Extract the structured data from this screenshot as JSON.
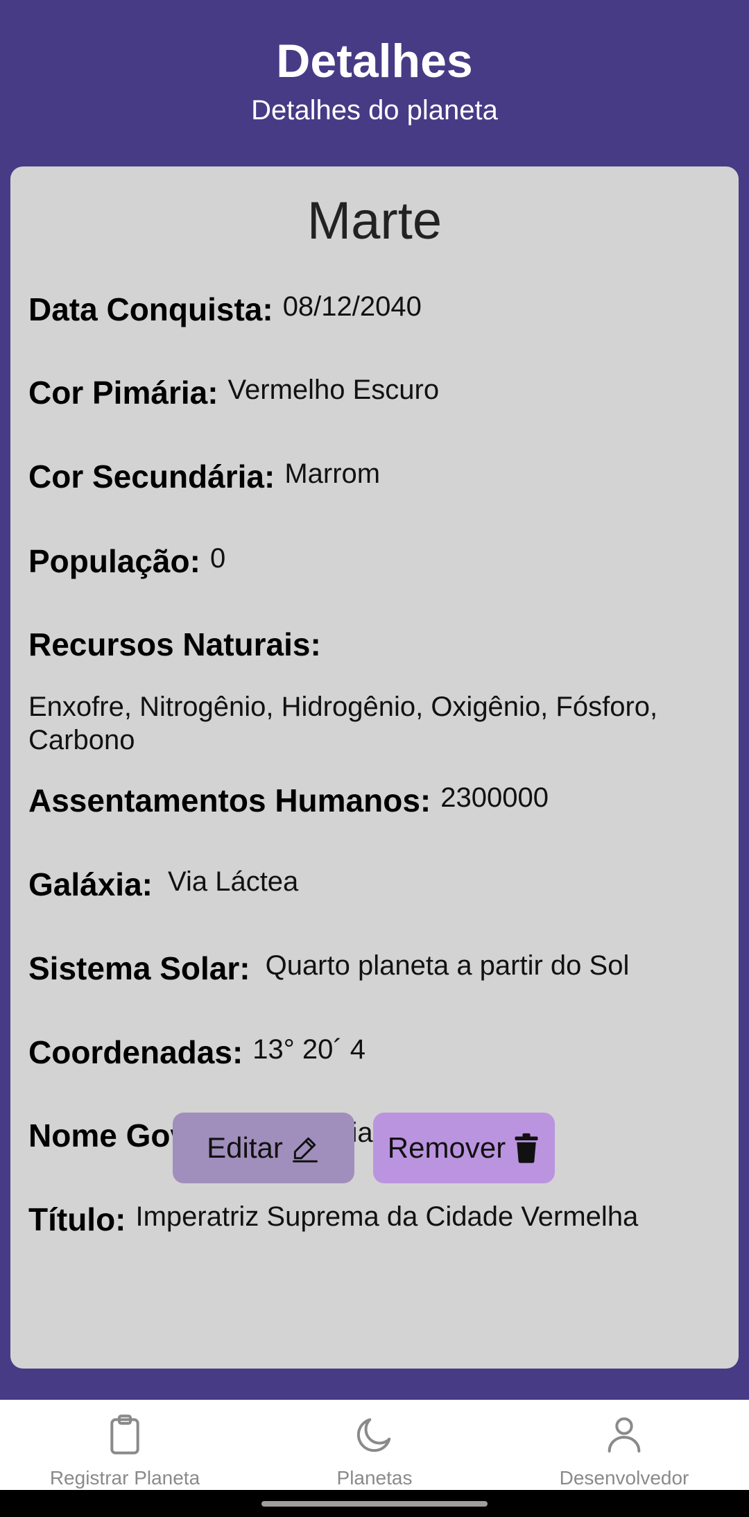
{
  "header": {
    "title": "Detalhes",
    "subtitle": "Detalhes do planeta"
  },
  "planet": {
    "name": "Marte",
    "fields": {
      "conquest_date": {
        "label": "Data Conquista:",
        "value": "08/12/2040"
      },
      "primary_color": {
        "label": "Cor Pimária:",
        "value": "Vermelho Escuro"
      },
      "secondary_color": {
        "label": "Cor Secundária:",
        "value": "Marrom"
      },
      "population": {
        "label": "População:",
        "value": "0"
      },
      "natural_resources": {
        "label": "Recursos Naturais:",
        "value": "Enxofre, Nitrogênio, Hidrogênio, Oxigênio, Fósforo, Carbono"
      },
      "human_settlements": {
        "label": "Assentamentos Humanos:",
        "value": "2300000"
      },
      "galaxy": {
        "label": "Galáxia:",
        "value": "Via Láctea"
      },
      "solar_system": {
        "label": "Sistema Solar:",
        "value": "Quarto planeta a partir do Sol"
      },
      "coordinates": {
        "label": "Coordenadas:",
        "value": "13° 20´ 4"
      },
      "ruler_name": {
        "label": "Nome Governante:",
        "value": "Arial"
      },
      "title": {
        "label": "Título:",
        "value": "Imperatriz Suprema da Cidade Vermelha"
      }
    }
  },
  "actions": {
    "edit_label": "Editar",
    "edit_icon": "pencil-icon",
    "remove_label": "Remover",
    "remove_icon": "trash-icon"
  },
  "bottom_nav": {
    "items": [
      {
        "label": "Registrar Planeta",
        "icon": "clipboard-icon"
      },
      {
        "label": "Planetas",
        "icon": "moon-icon"
      },
      {
        "label": "Desenvolvedor",
        "icon": "person-icon"
      }
    ]
  },
  "colors": {
    "header_bg": "#473b86",
    "card_bg": "#d3d3d3",
    "edit_button": "#a08fbc",
    "remove_button": "#bb94e0"
  }
}
